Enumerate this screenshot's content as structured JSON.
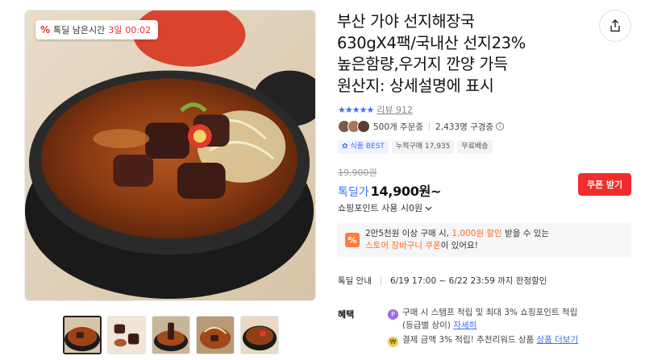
{
  "image_badge": {
    "icon": "%",
    "label": "톡딜 남은시간",
    "days": "3일",
    "time": "00:02"
  },
  "product": {
    "title_lines": [
      "부산 가야 선지해장국",
      "630gX4팩/국내산 선지23%",
      "높은함량,우거지 깐양 가득",
      "원산지: 상세설명에 표시"
    ]
  },
  "rating": {
    "stars": "★★★★★",
    "review_label": "리뷰 912"
  },
  "orders": {
    "order_count": "500개 주문중",
    "subscribers": "2,433명 구경중"
  },
  "tags": [
    "식품 BEST",
    "누적구매 17,935",
    "무료배송"
  ],
  "price": {
    "original": "19,900원",
    "sale_label": "톡딜가",
    "sale_price": "14,900원~",
    "coupon_button": "쿠폰 받기",
    "point_text": "쇼핑포인트 사용 시0원"
  },
  "promo": {
    "line1_pre": "2만5천원 이상 구매 시, ",
    "line1_hl": "1,000원 할인",
    "line1_post": " 받을 수 있는",
    "line2_hl": "스토어 장바구니 쿠폰",
    "line2_post": "이 있어요!",
    "icon": "%"
  },
  "deal": {
    "label": "톡딜 안내",
    "period": "6/19 17:00 ~ 6/22 23:59 까지 한정할인"
  },
  "benefits": {
    "label": "혜택",
    "item1_text": "구매 시 스탬프 적립 및 최대 3% 쇼핑포인트 적립",
    "item1_sub": "(등급별 상이)",
    "item1_link": "자세히",
    "item2_text": "결제 금액 3% 적립! 추천리워드 상품",
    "item2_link": "상품 더보기"
  },
  "colors": {
    "accent_blue": "#3f6cf5",
    "accent_red": "#f02c2c",
    "accent_orange": "#ff6a24"
  },
  "icons": {
    "share": "share-icon",
    "info": "info-icon",
    "chevron": "chevron-down-icon"
  }
}
